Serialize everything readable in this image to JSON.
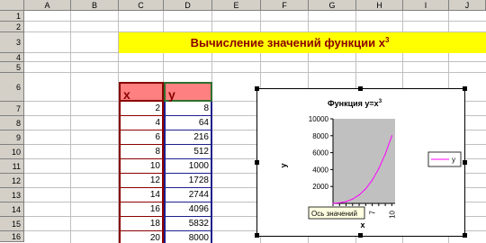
{
  "columns": [
    "A",
    "B",
    "C",
    "D",
    "E",
    "F",
    "G",
    "H",
    "I",
    "J"
  ],
  "rows": [
    "1",
    "2",
    "3",
    "4",
    "5",
    "6",
    "7",
    "8",
    "9",
    "10",
    "11",
    "12",
    "13",
    "14",
    "15",
    "16"
  ],
  "title": {
    "text": "Вычисление значений функции  x",
    "sup": "3"
  },
  "table": {
    "header_x": "x",
    "header_y": "y",
    "x_values": [
      "2",
      "4",
      "6",
      "8",
      "10",
      "12",
      "14",
      "16",
      "18",
      "20"
    ],
    "y_values": [
      "8",
      "64",
      "216",
      "512",
      "1000",
      "1728",
      "2744",
      "4096",
      "5832",
      "8000"
    ]
  },
  "chart": {
    "title_prefix": "Функция y=x",
    "title_sup": "3",
    "ylabel": "y",
    "xlabel": "x",
    "tooltip": "Ось значений",
    "yticks": [
      "10000",
      "8000",
      "6000",
      "4000",
      "2000"
    ],
    "xticks": [
      "7",
      "10"
    ],
    "legend": "y"
  },
  "colors": {
    "title_fill": "#ffff00",
    "title_text": "#8b0000",
    "header_fill": "#ff8080",
    "plot_area": "#c0c0c0",
    "series_line": "#ff00ff"
  },
  "chart_data": {
    "type": "line",
    "title": "Функция y=x³",
    "xlabel": "x",
    "ylabel": "y",
    "x": [
      2,
      4,
      6,
      8,
      10,
      12,
      14,
      16,
      18,
      20
    ],
    "series": [
      {
        "name": "y",
        "values": [
          8,
          64,
          216,
          512,
          1000,
          1728,
          2744,
          4096,
          5832,
          8000
        ]
      }
    ],
    "ylim": [
      0,
      10000
    ],
    "legend": "right"
  }
}
